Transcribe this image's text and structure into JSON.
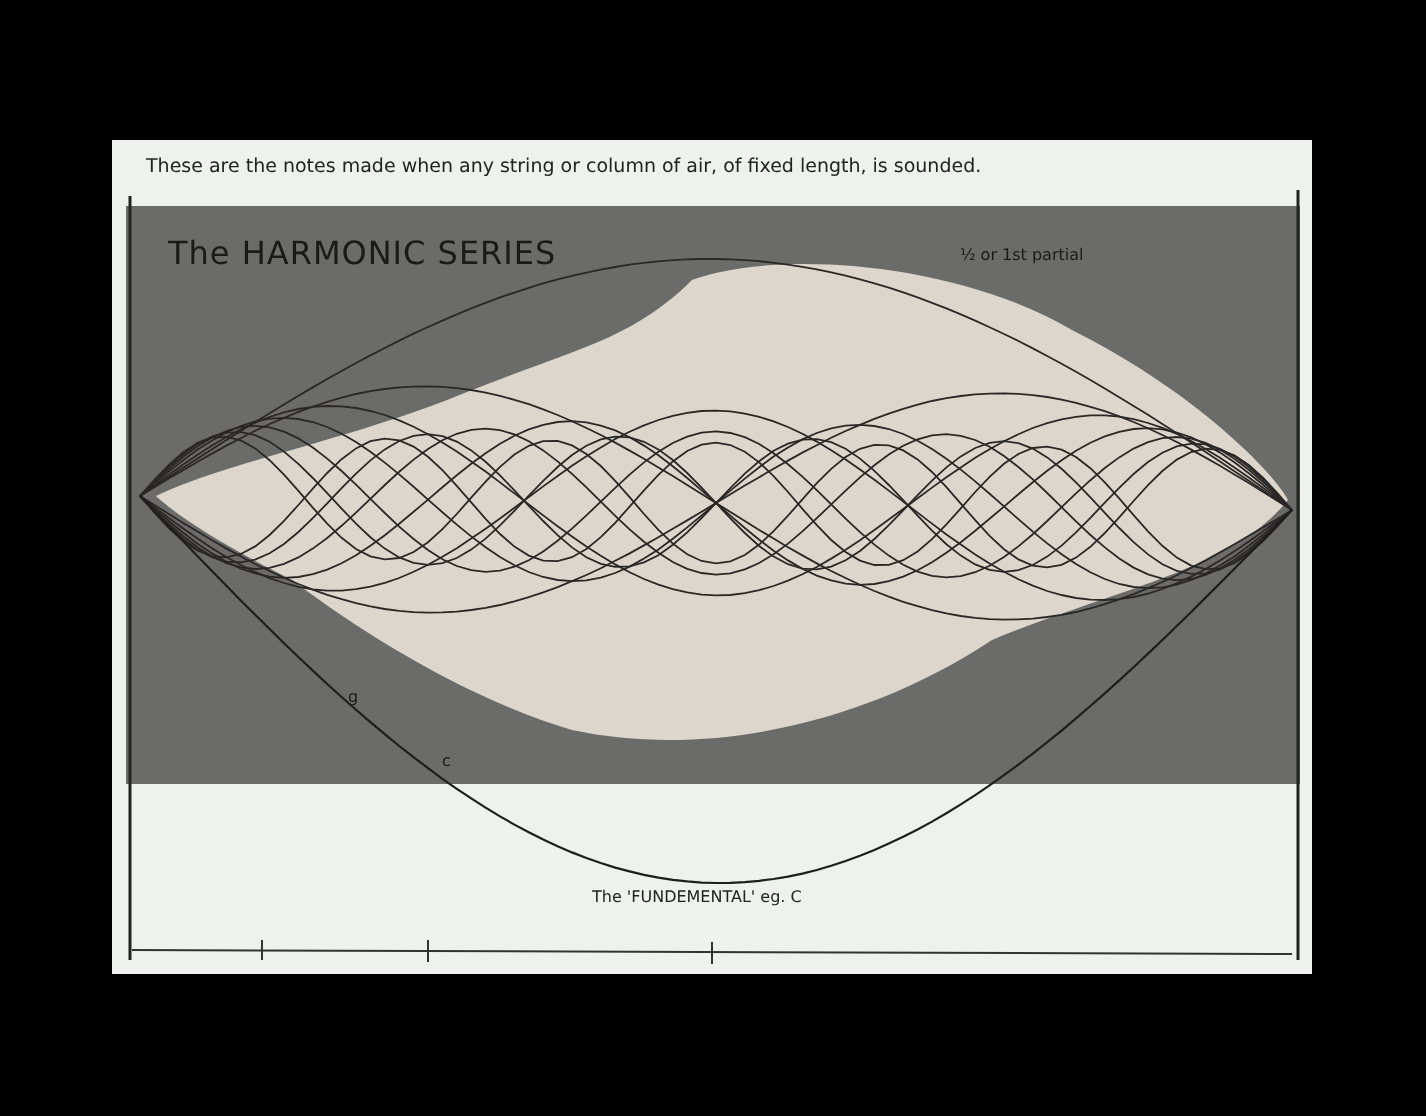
{
  "caption": "These are the notes made when any string or column of air, of fixed length, is sounded.",
  "title": "The HARMONIC SERIES",
  "partial_label": "½ or 1st partial",
  "note_labels": [
    "g",
    "c"
  ],
  "fundamental_label": "The 'FUNDEMENTAL' eg. C"
}
